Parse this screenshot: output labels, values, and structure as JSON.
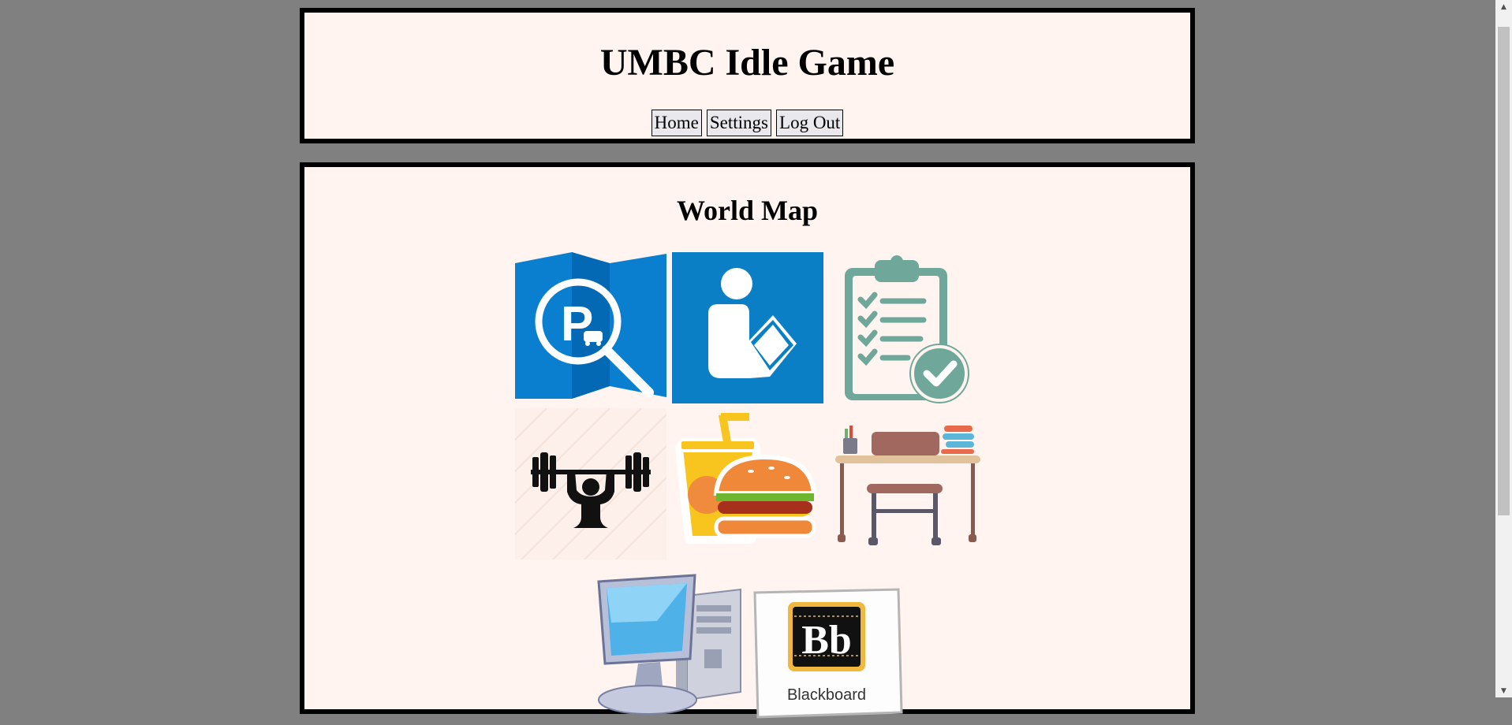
{
  "header": {
    "title": "UMBC Idle Game",
    "nav": [
      {
        "label": "Home"
      },
      {
        "label": "Settings"
      },
      {
        "label": "Log Out"
      }
    ]
  },
  "map": {
    "title": "World Map",
    "locations": [
      {
        "icon": "parking-map-icon"
      },
      {
        "icon": "library-reader-icon"
      },
      {
        "icon": "clipboard-checklist-icon"
      },
      {
        "icon": "weightlifter-gym-icon"
      },
      {
        "icon": "fast-food-burger-icon"
      },
      {
        "icon": "desk-chair-icon"
      },
      {
        "icon": "desktop-computer-icon"
      },
      {
        "icon": "blackboard-logo-icon",
        "logo_text": "Bb",
        "caption": "Blackboard"
      }
    ]
  },
  "colors": {
    "page_background": "#808080",
    "panel_background": "#fff4ef",
    "panel_border": "#000000"
  }
}
